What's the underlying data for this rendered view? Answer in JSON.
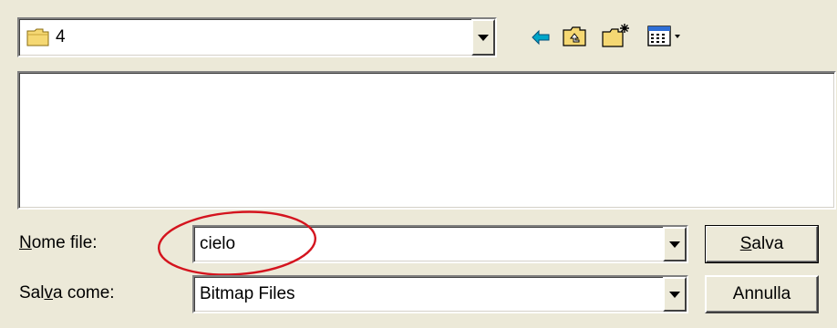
{
  "location": {
    "folder_name": "4",
    "icons": [
      "folder-icon",
      "back-arrow-icon",
      "up-folder-icon",
      "new-folder-icon",
      "view-menu-icon"
    ]
  },
  "file_list": {
    "items": []
  },
  "form": {
    "filename_label_first": "N",
    "filename_label_rest": "ome file:",
    "filename_value": "cielo",
    "saveas_label_first": "Sal",
    "saveas_label_underlined": "v",
    "saveas_label_rest": "a come:",
    "saveas_value": "Bitmap Files"
  },
  "buttons": {
    "save_first": "S",
    "save_rest": "alva",
    "cancel": "Annulla"
  },
  "highlight": {
    "color": "#d4141e"
  }
}
